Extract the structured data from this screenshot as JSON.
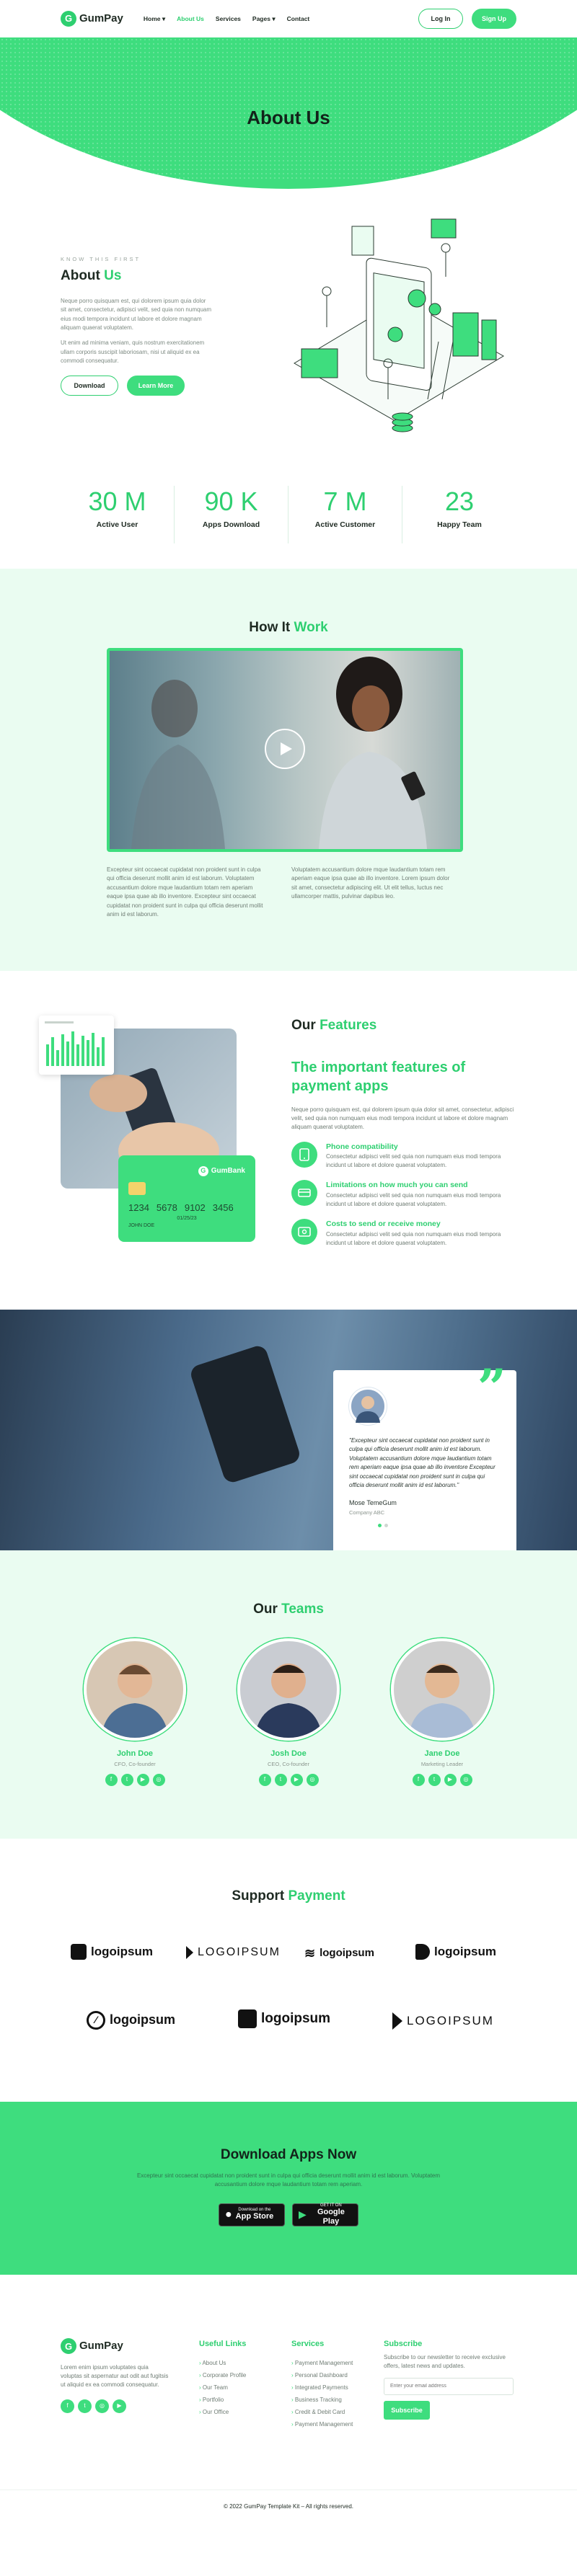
{
  "header": {
    "logo": "GumPay",
    "nav": [
      {
        "label": "Home",
        "has_dropdown": true
      },
      {
        "label": "About Us",
        "has_dropdown": false,
        "active": true
      },
      {
        "label": "Services",
        "has_dropdown": false
      },
      {
        "label": "Pages",
        "has_dropdown": true
      },
      {
        "label": "Contact",
        "has_dropdown": false
      }
    ],
    "login": "Log In",
    "signup": "Sign Up"
  },
  "hero": {
    "title": "About Us"
  },
  "about": {
    "kicker": "KNOW THIS FIRST",
    "title_a": "About ",
    "title_b": "Us",
    "p1": "Neque porro quisquam est, qui dolorem ipsum quia dolor sit amet, consectetur, adipisci velit, sed quia non numquam eius modi tempora incidunt ut labore et dolore magnam aliquam quaerat voluptatem.",
    "p2": "Ut enim ad minima veniam, quis nostrum exercitationem ullam corporis suscipit laboriosam, nisi ut aliquid ex ea commodi consequatur.",
    "btn_download": "Download",
    "btn_learn": "Learn More"
  },
  "stats": [
    {
      "num": "30 M",
      "label": "Active User"
    },
    {
      "num": "90 K",
      "label": "Apps Download"
    },
    {
      "num": "7 M",
      "label": "Active Customer"
    },
    {
      "num": "23",
      "label": "Happy Team"
    }
  ],
  "how": {
    "title_a": "How It ",
    "title_b": "Work",
    "col1": "Excepteur sint occaecat cupidatat non proident sunt in culpa qui officia deserunt mollit anim id est laborum. Voluptatem accusantium dolore mque laudantium totam rem aperiam eaque ipsa quae ab illo inventore. Excepteur sint occaecat cupidatat non proident sunt in culpa qui officia deserunt mollit anim id est laborum.",
    "col2": "Voluptatem accusantium dolore mque laudantium totam rem aperiam eaque ipsa quae ab illo inventore. Lorem ipsum dolor sit amet, consectetur adipiscing elit. Ut elit tellus, luctus nec ullamcorper mattis, pulvinar dapibus leo."
  },
  "features": {
    "title_a": "Our ",
    "title_b": "Features",
    "subtitle": "The important features of payment apps",
    "lead": "Neque porro quisquam est, qui dolorem ipsum quia dolor sit amet, consectetur, adipisci velit, sed quia non numquam eius modi tempora incidunt ut labore et dolore magnam aliquam quaerat voluptatem.",
    "items": [
      {
        "title": "Phone compatibility",
        "text": "Consectetur adipisci velit sed quia non numquam eius modi tempora incidunt ut labore et dolore quaerat voluptatem."
      },
      {
        "title": "Limitations on how much you can send",
        "text": "Consectetur adipisci velit sed quia non numquam eius modi tempora incidunt ut labore et dolore quaerat voluptatem."
      },
      {
        "title": "Costs to send or receive money",
        "text": "Consectetur adipisci velit sed quia non numquam eius modi tempora incidunt ut labore et dolore quaerat voluptatem."
      }
    ],
    "card": {
      "brand": "GumBank",
      "number": [
        "1234",
        "5678",
        "9102",
        "3456"
      ],
      "exp": "01/25/23",
      "holder": "JOHN DOE"
    }
  },
  "testimonial": {
    "quote": "\"Excepteur sint occaecat cupidatat non proident sunt in culpa qui officia deserunt mollit anim id est laborum. Voluptatem accusantium dolore mque laudantium totam rem aperiam eaque ipsa quae ab illo inventore Excepteur sint occaecat cupidatat non proident sunt in culpa qui officia deserunt mollit anim id est laborum.\"",
    "name": "Mose TemeGum",
    "company": "Company ABC"
  },
  "teams": {
    "title_a": "Our ",
    "title_b": "Teams",
    "members": [
      {
        "name": "John Doe",
        "role": "CFO, Co-founder"
      },
      {
        "name": "Josh Doe",
        "role": "CEO, Co-founder"
      },
      {
        "name": "Jane Doe",
        "role": "Marketing Leader"
      }
    ]
  },
  "support": {
    "title_a": "Support ",
    "title_b": "Payment",
    "logos": [
      "logoipsum",
      "LOGOIPSUM",
      "logoipsum",
      "logoipsum",
      "logoipsum",
      "logoipsum",
      "LOGOIPSUM"
    ]
  },
  "download": {
    "title": "Download Apps Now",
    "text": "Excepteur sint occaecat cupidatat non proident sunt in culpa qui officia deserunt mollit anim id est laborum. Voluptatem accusantium dolore mque laudantium totam rem aperiam.",
    "appstore_top": "Download on the",
    "appstore": "App Store",
    "gplay_top": "GET IT ON",
    "gplay": "Google Play"
  },
  "footer": {
    "about": "Lorem enim ipsum voluptates quia voluptas sit aspernatur aut odit aut fugitsis ut aliquid ex ea commodi consequatur.",
    "useful_title": "Useful Links",
    "useful": [
      "About Us",
      "Corporate Profile",
      "Our Team",
      "Portfolio",
      "Our Office"
    ],
    "services_title": "Services",
    "services": [
      "Payment Management",
      "Personal Dashboard",
      "Integrated Payments",
      "Business Tracking",
      "Credit & Debit Card",
      "Payment Management"
    ],
    "subscribe_title": "Subscribe",
    "subscribe_text": "Subscribe to our newsletter to receive exclusive offers, latest news and updates.",
    "email_placeholder": "Enter your email address",
    "subscribe_btn": "Subscribe",
    "copyright": "© 2022 GumPay Template Kit – All rights reserved."
  },
  "colors": {
    "accent": "#3edd7e",
    "accent_text": "#2ecf70",
    "light_bg": "#eafcf1"
  }
}
